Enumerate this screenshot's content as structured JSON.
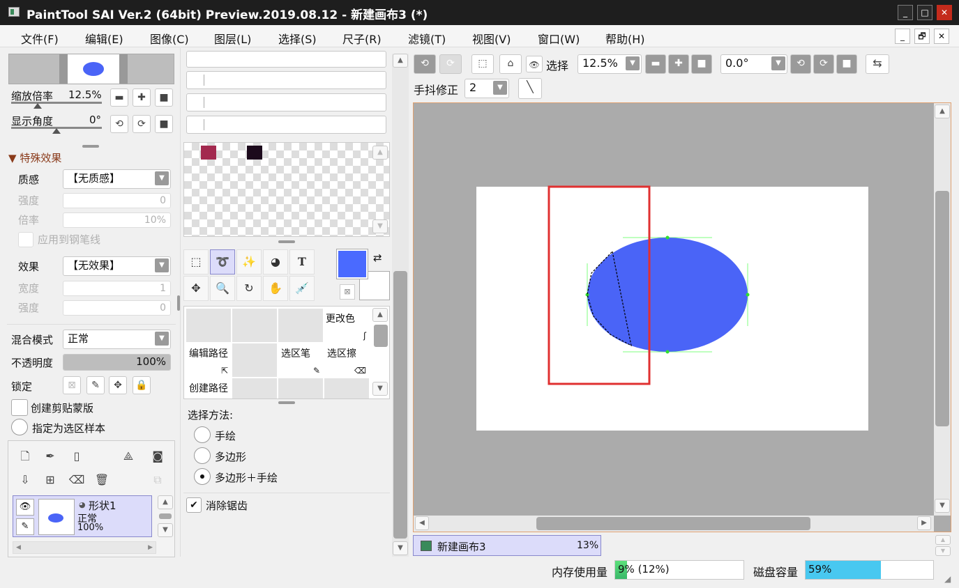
{
  "window": {
    "title": "PaintTool SAI Ver.2 (64bit) Preview.2019.08.12 - 新建画布3 (*)",
    "min": "_",
    "max": "□",
    "close": "✕"
  },
  "menu": [
    "文件(F)",
    "编辑(E)",
    "图像(C)",
    "图层(L)",
    "选择(S)",
    "尺子(R)",
    "滤镜(T)",
    "视图(V)",
    "窗口(W)",
    "帮助(H)"
  ],
  "mdi": {
    "min": "_",
    "restore": "🗗",
    "close": "✕"
  },
  "nav": {
    "zoom_label": "缩放倍率",
    "zoom_value": "12.5%",
    "angle_label": "显示角度",
    "angle_value": "0°"
  },
  "effects": {
    "header": "特殊效果",
    "texture_label": "质感",
    "texture_value": "【无质感】",
    "strength_label": "强度",
    "strength_value": "0",
    "scale_label": "倍率",
    "scale_value": "10%",
    "apply_pen": "应用到钢笔线",
    "effect_label": "效果",
    "effect_value": "【无效果】",
    "width_label": "宽度",
    "width_value": "1",
    "strength2_label": "强度",
    "strength2_value": "0"
  },
  "layerprops": {
    "blend_label": "混合模式",
    "blend_value": "正常",
    "opacity_label": "不透明度",
    "opacity_value": "100%",
    "opacity": 1.0,
    "lock_label": "锁定",
    "clip_label": "创建剪贴蒙版",
    "sample_label": "指定为选区样本"
  },
  "layer": {
    "name": "形状1",
    "mode": "正常",
    "opacity": "100%"
  },
  "swatches": [
    "#a3294f",
    "#1c0a1c"
  ],
  "colors": {
    "primary": "#4a6aff",
    "secondary": "#ffffff",
    "shape": "#4a64f7",
    "selection": "#e03030"
  },
  "toolgrid": {
    "change_color": "更改色",
    "edit_path": "编辑路径",
    "sel_pen": "选区笔",
    "sel_erase": "选区擦",
    "create_path": "创建路径"
  },
  "selmethod": {
    "label": "选择方法:",
    "freehand": "手绘",
    "polygon": "多边形",
    "poly_free": "多边形＋手绘",
    "antialias": "消除锯齿"
  },
  "toolbar": {
    "select_label": "选择",
    "zoom": "12.5%",
    "angle": "0.0°",
    "stab_label": "手抖修正",
    "stab_value": "2"
  },
  "canvas_tab": {
    "name": "新建画布3",
    "zoom": "13%"
  },
  "status": {
    "mem_label": "内存使用量",
    "mem_value": "9% (12%)",
    "mem": 0.09,
    "disk_label": "磁盘容量",
    "disk_value": "59%",
    "disk": 0.59
  }
}
